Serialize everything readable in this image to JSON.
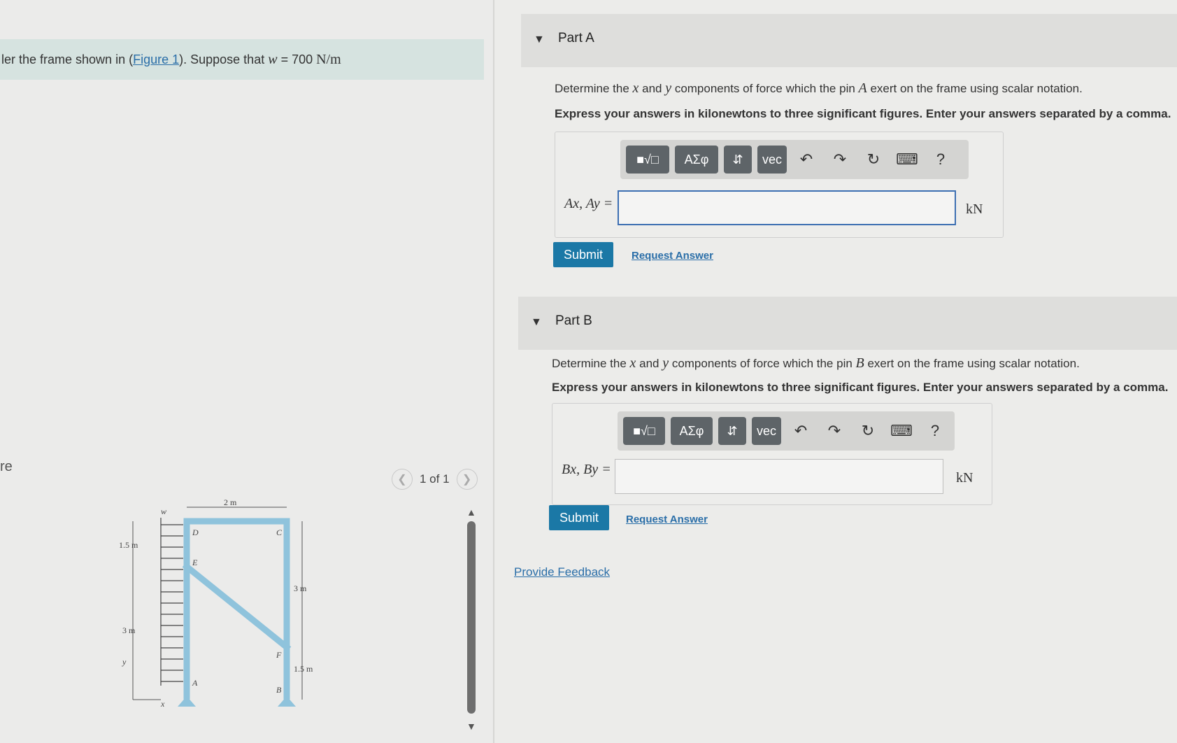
{
  "problem": {
    "prefix": "ler the frame shown in (",
    "figure_link": "Figure 1",
    "middle": "). Suppose that ",
    "var": "w",
    "eq": " = 700 ",
    "unit": "N/m"
  },
  "figure_panel": {
    "label": "re",
    "pager_text": "1 of 1",
    "labels": {
      "w": "w",
      "d": "D",
      "c": "C",
      "e": "E",
      "f": "F",
      "a": "A",
      "b": "B",
      "top_dim": "2 m",
      "left_upper_dim": "1.5 m",
      "left_lower_dim": "3 m",
      "right_upper_dim": "3 m",
      "right_lower_dim": "1.5 m",
      "y": "y",
      "x": "x"
    }
  },
  "partA": {
    "title": "Part A",
    "question_pre": "Determine the ",
    "x": "x",
    "and": " and ",
    "y": "y",
    "question_mid": " components of force which the pin ",
    "pin": "A",
    "question_post": " exert on the frame using scalar notation.",
    "instructions": "Express your answers in kilonewtons to three significant figures. Enter your answers separated by a comma.",
    "label": "Ax, Ay =",
    "unit": "kN",
    "submit": "Submit",
    "request": "Request Answer"
  },
  "partB": {
    "title": "Part B",
    "question_pre": "Determine the ",
    "x": "x",
    "and": " and ",
    "y": "y",
    "question_mid": " components of force which the pin ",
    "pin": "B",
    "question_post": " exert on the frame using scalar notation.",
    "instructions": "Express your answers in kilonewtons to three significant figures. Enter your answers separated by a comma.",
    "label": "Bx, By =",
    "unit": "kN",
    "submit": "Submit",
    "request": "Request Answer"
  },
  "toolbar": {
    "templates": "■√□",
    "greek": "ΑΣφ",
    "updown": "⇵",
    "vec": "vec",
    "help": "?"
  },
  "feedback": "Provide Feedback",
  "colors": {
    "link": "#2a6ea8",
    "submit": "#1b78a6",
    "frame": "#8fc3dc",
    "toolbar_btn": "#5e6468"
  }
}
